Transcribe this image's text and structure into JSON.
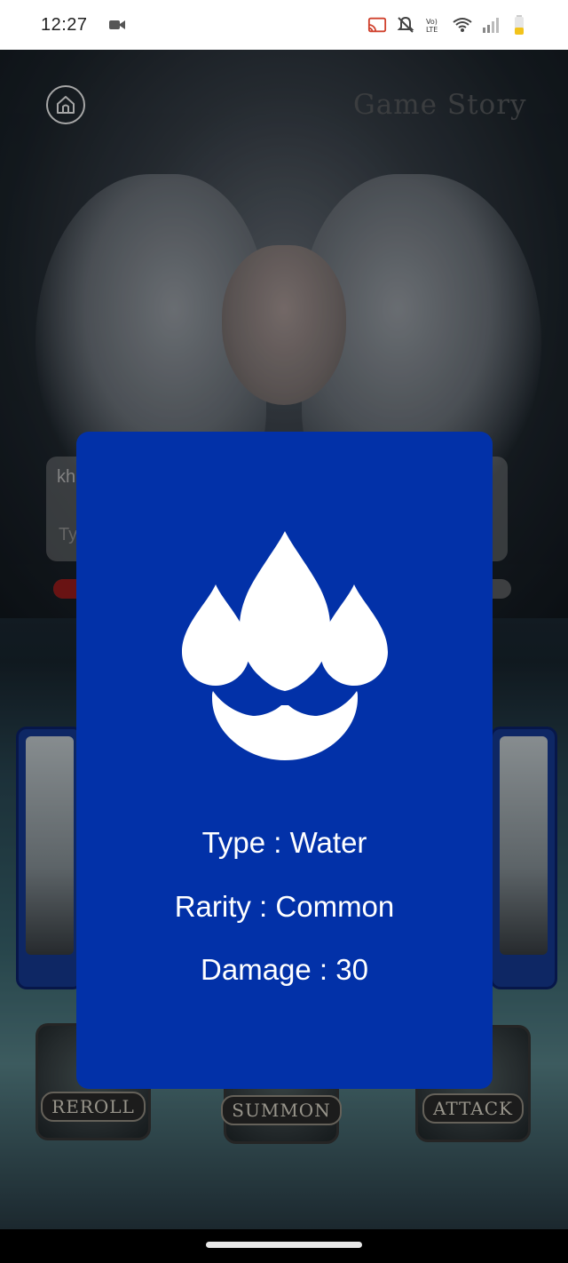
{
  "status_bar": {
    "time": "12:27",
    "icons": [
      "video-camera-icon",
      "cast-icon",
      "bell-off-icon",
      "volte-icon",
      "wifi-icon",
      "cellular-signal-icon",
      "battery-icon"
    ],
    "volte_label": "Vo) LTE"
  },
  "header": {
    "title": "Game Story",
    "home_icon": "home-icon"
  },
  "story": {
    "chat_text": "kh",
    "input_placeholder": "Ty"
  },
  "actions": [
    {
      "label": "REROLL"
    },
    {
      "label": "SUMMON"
    },
    {
      "label": "ATTACK"
    }
  ],
  "modal": {
    "icon": "water-drops-icon",
    "type_text": "Type : Water",
    "rarity_text": "Rarity : Common",
    "damage_text": "Damage : 30",
    "background_color": "#0231a8"
  }
}
